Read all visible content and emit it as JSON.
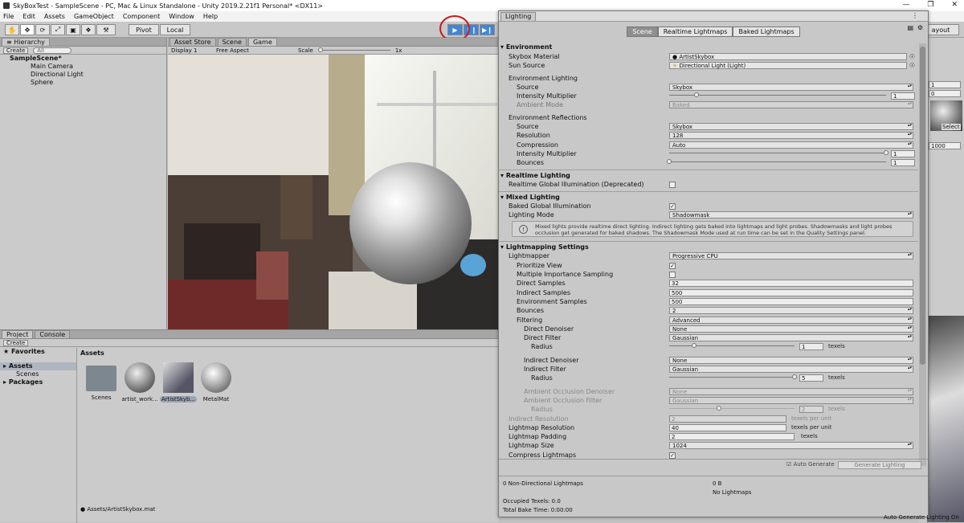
{
  "window": {
    "title": "SkyBoxTest - SampleScene - PC, Mac & Linux Standalone - Unity 2019.2.21f1 Personal* <DX11>"
  },
  "menu": [
    "File",
    "Edit",
    "Assets",
    "GameObject",
    "Component",
    "Window",
    "Help"
  ],
  "toolbar": {
    "pivot": "Pivot",
    "local": "Local",
    "layout": "ayout"
  },
  "hierarchy": {
    "tab": "Hierarchy",
    "create": "Create",
    "search": "All",
    "scene": "SampleScene*",
    "items": [
      "Main Camera",
      "Directional Light",
      "Sphere"
    ]
  },
  "game": {
    "tabs": [
      "Asset Store",
      "Scene",
      "Game"
    ],
    "display": "Display 1",
    "aspect": "Free Aspect",
    "scale_label": "Scale",
    "scale_value": "1x"
  },
  "project": {
    "tabs": [
      "Project",
      "Console"
    ],
    "create": "Create",
    "favorites": "Favorites",
    "assets": "Assets",
    "scenes": "Scenes",
    "packages": "Packages",
    "header": "Assets",
    "items": [
      "Scenes",
      "artist_work...",
      "ArtistSkyb...",
      "MetalMat"
    ],
    "path": "Assets/ArtistSkybox.mat"
  },
  "inspector": {
    "v1": "1",
    "v2": "0",
    "select": "Select",
    "v3": "1000"
  },
  "lighting": {
    "title": "Lighting",
    "tabs": [
      "Scene",
      "Realtime Lightmaps",
      "Baked Lightmaps"
    ],
    "environment": "Environment",
    "skybox_material_label": "Skybox Material",
    "skybox_material": "ArtistSkybox",
    "sun_source_label": "Sun Source",
    "sun_source": "Directional Light (Light)",
    "env_lighting": "Environment Lighting",
    "source_label": "Source",
    "source": "Skybox",
    "intensity_label": "Intensity Multiplier",
    "intensity": "1",
    "intensity_frac": 0.125,
    "ambient_mode_label": "Ambient Mode",
    "ambient_mode": "Baked",
    "env_reflections": "Environment Reflections",
    "refl_source_label": "Source",
    "refl_source": "Skybox",
    "resolution_label": "Resolution",
    "resolution": "128",
    "compression_label": "Compression",
    "compression": "Auto",
    "refl_intensity_label": "Intensity Multiplier",
    "refl_intensity": "1",
    "refl_intensity_frac": 1.0,
    "bounces_label": "Bounces",
    "bounces": "1",
    "bounces_frac": 0.0,
    "realtime": "Realtime Lighting",
    "realtime_gi_label": "Realtime Global Illumination (Deprecated)",
    "mixed": "Mixed Lighting",
    "baked_gi_label": "Baked Global Illumination",
    "lighting_mode_label": "Lighting Mode",
    "lighting_mode": "Shadowmask",
    "mixed_note": "Mixed lights provide realtime direct lighting. Indirect lighting gets baked into lightmaps and light probes. Shadowmasks and light probes occlusion get generated for baked shadows. The Shadowmask Mode used at run time can be set in the Quality Settings panel.",
    "lightmapping": "Lightmapping Settings",
    "lightmapper_label": "Lightmapper",
    "lightmapper": "Progressive CPU",
    "prioritize_label": "Prioritize View",
    "mis_label": "Multiple Importance Sampling",
    "direct_samples_label": "Direct Samples",
    "direct_samples": "32",
    "indirect_samples_label": "Indirect Samples",
    "indirect_samples": "500",
    "env_samples_label": "Environment Samples",
    "env_samples": "500",
    "lm_bounces_label": "Bounces",
    "lm_bounces": "2",
    "filtering_label": "Filtering",
    "filtering": "Advanced",
    "direct_denoiser_label": "Direct Denoiser",
    "direct_denoiser": "None",
    "direct_filter_label": "Direct Filter",
    "direct_filter": "Gaussian",
    "radius_label": "Radius",
    "direct_radius": "1",
    "direct_radius_frac": 0.2,
    "indirect_denoiser_label": "Indirect Denoiser",
    "indirect_denoiser": "None",
    "indirect_filter_label": "Indirect Filter",
    "indirect_filter": "Gaussian",
    "indirect_radius": "5",
    "indirect_radius_frac": 1.0,
    "ao_denoiser_label": "Ambient Occlusion Denoiser",
    "ao_denoiser": "None",
    "ao_filter_label": "Ambient Occlusion Filter",
    "ao_filter": "Gaussian",
    "ao_radius": "2",
    "ao_radius_frac": 0.4,
    "texels": "texels",
    "indirect_res_label": "Indirect Resolution",
    "indirect_res": "2",
    "lightmap_res_label": "Lightmap Resolution",
    "lightmap_res": "40",
    "texels_per_unit": "texels per unit",
    "padding_label": "Lightmap Padding",
    "padding": "2",
    "size_label": "Lightmap Size",
    "size": "1024",
    "compress_label": "Compress Lightmaps",
    "auto_generate": "Auto Generate",
    "generate": "Generate Lighting",
    "footer": {
      "left1": "0 Non-Directional Lightmaps",
      "right1": "0 B",
      "right2": "No Lightmaps",
      "occupied": "Occupied Texels: 0.0",
      "bake_time": "Total Bake Time: 0:00:00"
    },
    "status_right": "Auto Generate Lighting On"
  }
}
